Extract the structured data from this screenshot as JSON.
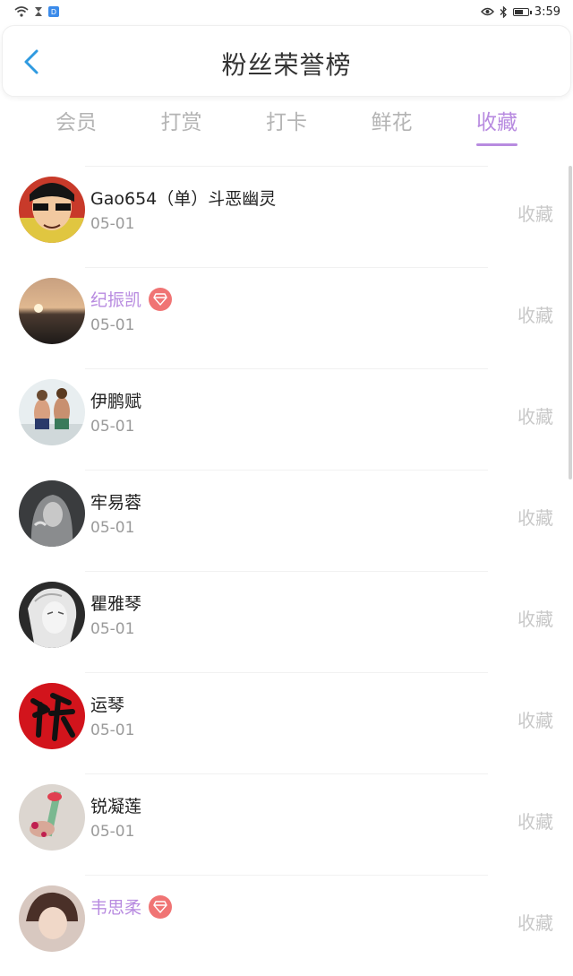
{
  "status_bar": {
    "time": "3:59"
  },
  "header": {
    "title": "粉丝荣誉榜"
  },
  "tabs": [
    {
      "label": "会员",
      "active": false
    },
    {
      "label": "打赏",
      "active": false
    },
    {
      "label": "打卡",
      "active": false
    },
    {
      "label": "鲜花",
      "active": false
    },
    {
      "label": "收藏",
      "active": true
    }
  ],
  "list": [
    {
      "name": "Gao654（单）斗恶幽灵",
      "date": "05-01",
      "action": "收藏",
      "vip": false
    },
    {
      "name": "纪振凯",
      "date": "05-01",
      "action": "收藏",
      "vip": true
    },
    {
      "name": "伊鹏赋",
      "date": "05-01",
      "action": "收藏",
      "vip": false
    },
    {
      "name": "牢易蓉",
      "date": "05-01",
      "action": "收藏",
      "vip": false
    },
    {
      "name": "瞿雅琴",
      "date": "05-01",
      "action": "收藏",
      "vip": false
    },
    {
      "name": "运琴",
      "date": "05-01",
      "action": "收藏",
      "vip": false
    },
    {
      "name": "锐凝莲",
      "date": "05-01",
      "action": "收藏",
      "vip": false
    },
    {
      "name": "韦思柔",
      "date": "",
      "action": "收藏",
      "vip": true
    }
  ],
  "colors": {
    "accent": "#b88be0",
    "vip_badge": "#f07474",
    "muted": "#c8c8c8"
  }
}
